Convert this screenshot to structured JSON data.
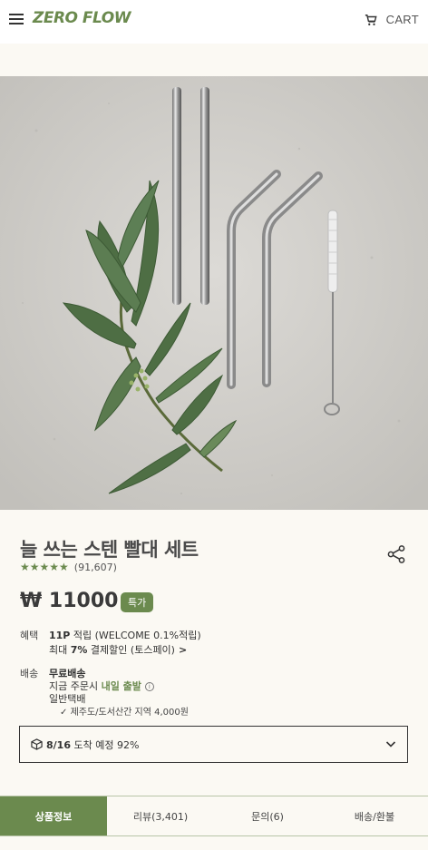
{
  "header": {
    "logo": "ZERO FLOW",
    "cart_label": "CART",
    "menu_icon": "hamburger-icon",
    "cart_icon": "cart-icon"
  },
  "product": {
    "title": "늘 쓰는 스텐 빨대 세트",
    "rating_count": "(91,607)",
    "stars": "★★★★★",
    "price": "₩ 11000",
    "badge": "특가",
    "share_icon": "share-icon"
  },
  "benefit": {
    "label": "혜택",
    "line1_bold": "11P",
    "line1_rest": " 적립 (WELCOME 0.1%적립)",
    "line2_pre": "최대 ",
    "line2_bold": "7%",
    "line2_rest": " 결제할인 (토스페이)",
    "line2_arrow": ">"
  },
  "shipping": {
    "label": "배송",
    "free": "무료배송",
    "order_pre": "지금 주문시 ",
    "order_highlight": "내일 출발",
    "info": "i",
    "type": "일반택배",
    "extra_check": "✓",
    "extra": "제주도/도서산간 지역 4,000원"
  },
  "delivery": {
    "date": "8/16",
    "text": " 도착 예정 92%"
  },
  "tabs": [
    {
      "label": "상품정보",
      "active": true
    },
    {
      "label": "리뷰(3,401)",
      "active": false
    },
    {
      "label": "문의(6)",
      "active": false
    },
    {
      "label": "배송/환불",
      "active": false
    }
  ],
  "colors": {
    "accent": "#6b8a4e",
    "background": "#fbf9f3"
  }
}
